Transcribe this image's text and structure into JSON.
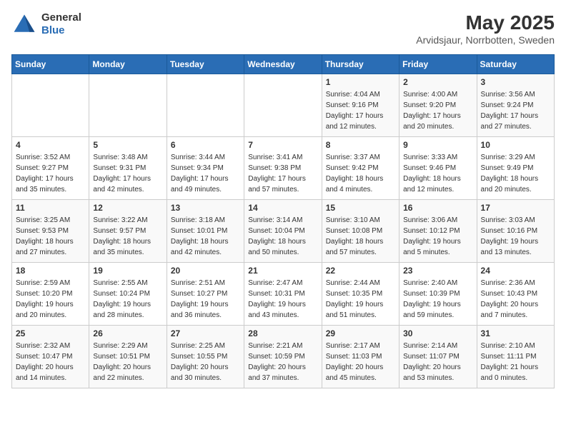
{
  "app": {
    "name": "GeneralBlue",
    "logo_line1": "General",
    "logo_line2": "Blue"
  },
  "calendar": {
    "month_year": "May 2025",
    "location": "Arvidsjaur, Norrbotten, Sweden",
    "days_of_week": [
      "Sunday",
      "Monday",
      "Tuesday",
      "Wednesday",
      "Thursday",
      "Friday",
      "Saturday"
    ],
    "weeks": [
      [
        {
          "day": "",
          "info": ""
        },
        {
          "day": "",
          "info": ""
        },
        {
          "day": "",
          "info": ""
        },
        {
          "day": "",
          "info": ""
        },
        {
          "day": "1",
          "info": "Sunrise: 4:04 AM\nSunset: 9:16 PM\nDaylight: 17 hours\nand 12 minutes."
        },
        {
          "day": "2",
          "info": "Sunrise: 4:00 AM\nSunset: 9:20 PM\nDaylight: 17 hours\nand 20 minutes."
        },
        {
          "day": "3",
          "info": "Sunrise: 3:56 AM\nSunset: 9:24 PM\nDaylight: 17 hours\nand 27 minutes."
        }
      ],
      [
        {
          "day": "4",
          "info": "Sunrise: 3:52 AM\nSunset: 9:27 PM\nDaylight: 17 hours\nand 35 minutes."
        },
        {
          "day": "5",
          "info": "Sunrise: 3:48 AM\nSunset: 9:31 PM\nDaylight: 17 hours\nand 42 minutes."
        },
        {
          "day": "6",
          "info": "Sunrise: 3:44 AM\nSunset: 9:34 PM\nDaylight: 17 hours\nand 49 minutes."
        },
        {
          "day": "7",
          "info": "Sunrise: 3:41 AM\nSunset: 9:38 PM\nDaylight: 17 hours\nand 57 minutes."
        },
        {
          "day": "8",
          "info": "Sunrise: 3:37 AM\nSunset: 9:42 PM\nDaylight: 18 hours\nand 4 minutes."
        },
        {
          "day": "9",
          "info": "Sunrise: 3:33 AM\nSunset: 9:46 PM\nDaylight: 18 hours\nand 12 minutes."
        },
        {
          "day": "10",
          "info": "Sunrise: 3:29 AM\nSunset: 9:49 PM\nDaylight: 18 hours\nand 20 minutes."
        }
      ],
      [
        {
          "day": "11",
          "info": "Sunrise: 3:25 AM\nSunset: 9:53 PM\nDaylight: 18 hours\nand 27 minutes."
        },
        {
          "day": "12",
          "info": "Sunrise: 3:22 AM\nSunset: 9:57 PM\nDaylight: 18 hours\nand 35 minutes."
        },
        {
          "day": "13",
          "info": "Sunrise: 3:18 AM\nSunset: 10:01 PM\nDaylight: 18 hours\nand 42 minutes."
        },
        {
          "day": "14",
          "info": "Sunrise: 3:14 AM\nSunset: 10:04 PM\nDaylight: 18 hours\nand 50 minutes."
        },
        {
          "day": "15",
          "info": "Sunrise: 3:10 AM\nSunset: 10:08 PM\nDaylight: 18 hours\nand 57 minutes."
        },
        {
          "day": "16",
          "info": "Sunrise: 3:06 AM\nSunset: 10:12 PM\nDaylight: 19 hours\nand 5 minutes."
        },
        {
          "day": "17",
          "info": "Sunrise: 3:03 AM\nSunset: 10:16 PM\nDaylight: 19 hours\nand 13 minutes."
        }
      ],
      [
        {
          "day": "18",
          "info": "Sunrise: 2:59 AM\nSunset: 10:20 PM\nDaylight: 19 hours\nand 20 minutes."
        },
        {
          "day": "19",
          "info": "Sunrise: 2:55 AM\nSunset: 10:24 PM\nDaylight: 19 hours\nand 28 minutes."
        },
        {
          "day": "20",
          "info": "Sunrise: 2:51 AM\nSunset: 10:27 PM\nDaylight: 19 hours\nand 36 minutes."
        },
        {
          "day": "21",
          "info": "Sunrise: 2:47 AM\nSunset: 10:31 PM\nDaylight: 19 hours\nand 43 minutes."
        },
        {
          "day": "22",
          "info": "Sunrise: 2:44 AM\nSunset: 10:35 PM\nDaylight: 19 hours\nand 51 minutes."
        },
        {
          "day": "23",
          "info": "Sunrise: 2:40 AM\nSunset: 10:39 PM\nDaylight: 19 hours\nand 59 minutes."
        },
        {
          "day": "24",
          "info": "Sunrise: 2:36 AM\nSunset: 10:43 PM\nDaylight: 20 hours\nand 7 minutes."
        }
      ],
      [
        {
          "day": "25",
          "info": "Sunrise: 2:32 AM\nSunset: 10:47 PM\nDaylight: 20 hours\nand 14 minutes."
        },
        {
          "day": "26",
          "info": "Sunrise: 2:29 AM\nSunset: 10:51 PM\nDaylight: 20 hours\nand 22 minutes."
        },
        {
          "day": "27",
          "info": "Sunrise: 2:25 AM\nSunset: 10:55 PM\nDaylight: 20 hours\nand 30 minutes."
        },
        {
          "day": "28",
          "info": "Sunrise: 2:21 AM\nSunset: 10:59 PM\nDaylight: 20 hours\nand 37 minutes."
        },
        {
          "day": "29",
          "info": "Sunrise: 2:17 AM\nSunset: 11:03 PM\nDaylight: 20 hours\nand 45 minutes."
        },
        {
          "day": "30",
          "info": "Sunrise: 2:14 AM\nSunset: 11:07 PM\nDaylight: 20 hours\nand 53 minutes."
        },
        {
          "day": "31",
          "info": "Sunrise: 2:10 AM\nSunset: 11:11 PM\nDaylight: 21 hours\nand 0 minutes."
        }
      ]
    ]
  }
}
